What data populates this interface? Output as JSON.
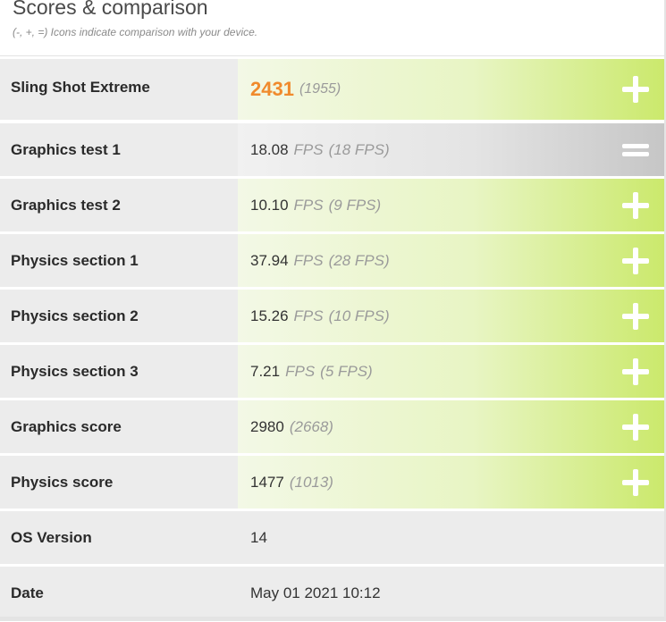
{
  "header": {
    "title": "Scores & comparison",
    "subtitle": "(-, +, =) Icons indicate comparison with your device."
  },
  "rows": [
    {
      "label": "Sling Shot Extreme",
      "value": "2431",
      "unit": "",
      "compare": "(1955)",
      "comparison": "plus",
      "icon": "plus-icon"
    },
    {
      "label": "Graphics test 1",
      "value": "18.08",
      "unit": "FPS",
      "compare": "(18 FPS)",
      "comparison": "equal",
      "icon": "equals-icon"
    },
    {
      "label": "Graphics test 2",
      "value": "10.10",
      "unit": "FPS",
      "compare": "(9 FPS)",
      "comparison": "plus",
      "icon": "plus-icon"
    },
    {
      "label": "Physics section 1",
      "value": "37.94",
      "unit": "FPS",
      "compare": "(28 FPS)",
      "comparison": "plus",
      "icon": "plus-icon"
    },
    {
      "label": "Physics section 2",
      "value": "15.26",
      "unit": "FPS",
      "compare": "(10 FPS)",
      "comparison": "plus",
      "icon": "plus-icon"
    },
    {
      "label": "Physics section 3",
      "value": "7.21",
      "unit": "FPS",
      "compare": "(5 FPS)",
      "comparison": "plus",
      "icon": "plus-icon"
    },
    {
      "label": "Graphics score",
      "value": "2980",
      "unit": "",
      "compare": "(2668)",
      "comparison": "plus",
      "icon": "plus-icon"
    },
    {
      "label": "Physics score",
      "value": "1477",
      "unit": "",
      "compare": "(1013)",
      "comparison": "plus",
      "icon": "plus-icon"
    },
    {
      "label": "OS Version",
      "value": "14",
      "unit": "",
      "compare": "",
      "comparison": "none",
      "icon": ""
    },
    {
      "label": "Date",
      "value": "May 01 2021 10:12",
      "unit": "",
      "compare": "",
      "comparison": "none",
      "icon": ""
    }
  ],
  "colors": {
    "score_accent": "#f08a2c",
    "better_gradient_end": "#cbe96c",
    "equal_gradient_end": "#c6c6c6",
    "row_background": "#ececec"
  }
}
